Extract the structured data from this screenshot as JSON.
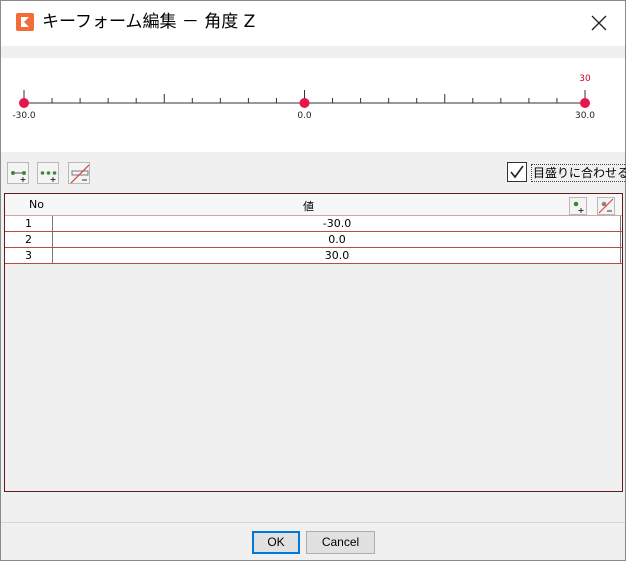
{
  "window": {
    "title": "キーフォーム編集 － 角度 Z",
    "icons": {
      "app": "app-logo-icon",
      "close": "close-icon"
    }
  },
  "timeline": {
    "min_label": "-30.0",
    "mid_label": "0.0",
    "max_label": "30.0",
    "current_label": "30",
    "keys": [
      -30,
      0,
      30
    ],
    "range": [
      -30,
      30
    ],
    "current_value": 30,
    "colors": {
      "key": "#e8174b",
      "current": "#d0021b",
      "axis": "#333333"
    }
  },
  "toolbar": {
    "icons": [
      "add-key-icon",
      "add-multiple-keys-icon",
      "delete-all-keys-icon"
    ],
    "fit_to_scale": {
      "label": "目盛りに合わせる",
      "checked": true
    }
  },
  "table": {
    "headers": {
      "no": "No",
      "value": "値"
    },
    "row_icons": [
      "add-row-icon",
      "delete-row-icon"
    ],
    "rows": [
      {
        "no": "1",
        "value": "-30.0"
      },
      {
        "no": "2",
        "value": "0.0"
      },
      {
        "no": "3",
        "value": "30.0"
      }
    ]
  },
  "buttons": {
    "ok": "OK",
    "cancel": "Cancel"
  }
}
